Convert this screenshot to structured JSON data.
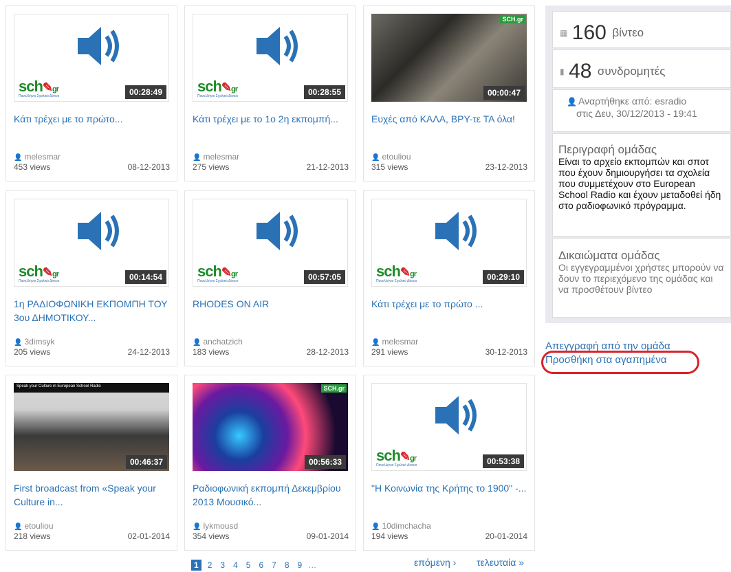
{
  "videos": [
    {
      "title": "Κάτι τρέχει με το πρώτο...",
      "user": "melesmar",
      "views": "453 views",
      "date": "08-12-2013",
      "duration": "00:28:49",
      "thumb": "speaker"
    },
    {
      "title": "Κάτι τρέχει με το 1ο 2η εκπομπή...",
      "user": "melesmar",
      "views": "275 views",
      "date": "21-12-2013",
      "duration": "00:28:55",
      "thumb": "speaker"
    },
    {
      "title": "Ευχές από ΚΑΛΑ, ΒΡΥ-τε ΤΑ όλα!",
      "user": "etouliou",
      "views": "315 views",
      "date": "23-12-2013",
      "duration": "00:00:47",
      "thumb": "photo-meeting"
    },
    {
      "title": "1η ΡΑΔΙΟΦΩΝΙΚΗ ΕΚΠΟΜΠΗ ΤΟΥ 3ου ΔΗΜΟΤΙΚΟΥ...",
      "user": "3dimsyk",
      "views": "205 views",
      "date": "24-12-2013",
      "duration": "00:14:54",
      "thumb": "speaker"
    },
    {
      "title": "RHODES ON AIR",
      "user": "anchatzich",
      "views": "183 views",
      "date": "28-12-2013",
      "duration": "00:57:05",
      "thumb": "speaker"
    },
    {
      "title": "Κάτι τρέχει με το πρώτο ...",
      "user": "melesmar",
      "views": "291 views",
      "date": "30-12-2013",
      "duration": "00:29:10",
      "thumb": "speaker"
    },
    {
      "title": "First broadcast from «Speak your Culture in...",
      "user": "etouliou",
      "views": "218 views",
      "date": "02-01-2014",
      "duration": "00:46:37",
      "thumb": "photo-class",
      "banner": "Speak your Culture in European School Radio"
    },
    {
      "title": "Ραδιοφωνική εκπομπή Δεκεμβρίου 2013 Μουσικό...",
      "user": "lykmousd",
      "views": "354 views",
      "date": "09-01-2014",
      "duration": "00:56:33",
      "thumb": "photo-lights"
    },
    {
      "title": "\"Η Κοινωνία της Κρήτης το 1900\" -...",
      "user": "10dimchacha",
      "views": "194 views",
      "date": "20-01-2014",
      "duration": "00:53:38",
      "thumb": "speaker"
    }
  ],
  "logo": {
    "text": "sch",
    "suffix": "gr",
    "sub": "Πανελλήνιο Σχολικό Δίκτυο",
    "badge": "SCH.gr"
  },
  "pager": {
    "pages": [
      "1",
      "2",
      "3",
      "4",
      "5",
      "6",
      "7",
      "8",
      "9"
    ],
    "current": "1",
    "ellipsis": "…",
    "next": "επόμενη ›",
    "last": "τελευταία »"
  },
  "sidebar": {
    "videos_count": "160",
    "videos_label": "βίντεο",
    "subscribers_count": "48",
    "subscribers_label": "συνδρομητές",
    "uploaded_line1": "Αναρτήθηκε από: esradio",
    "uploaded_line2": "στις Δευ, 30/12/2013 - 19:41",
    "description_title": "Περιγραφή ομάδας",
    "description_text": "Είναι το αρχείο εκπομπών και σποτ που έχουν δημιουργήσει τα σχολεία που συμμετέχουν στο European School Radio και έχουν μεταδοθεί ήδη στο ραδιοφωνικό πρόγραμμα.",
    "rights_title": "Δικαιώματα ομάδας",
    "rights_text": "Οι εγγεγραμμένοι χρήστες μπορούν να δουν το περιεχόμενο της ομάδας και να προσθέτουν βίντεο",
    "unsubscribe": "Απεγγραφή από την ομάδα",
    "add_favorites": "Προσθήκη στα αγαπημένα"
  },
  "colors": {
    "link": "#2a72b5",
    "highlight": "#d8232a",
    "sidebar_bg": "#e9e9ef"
  }
}
